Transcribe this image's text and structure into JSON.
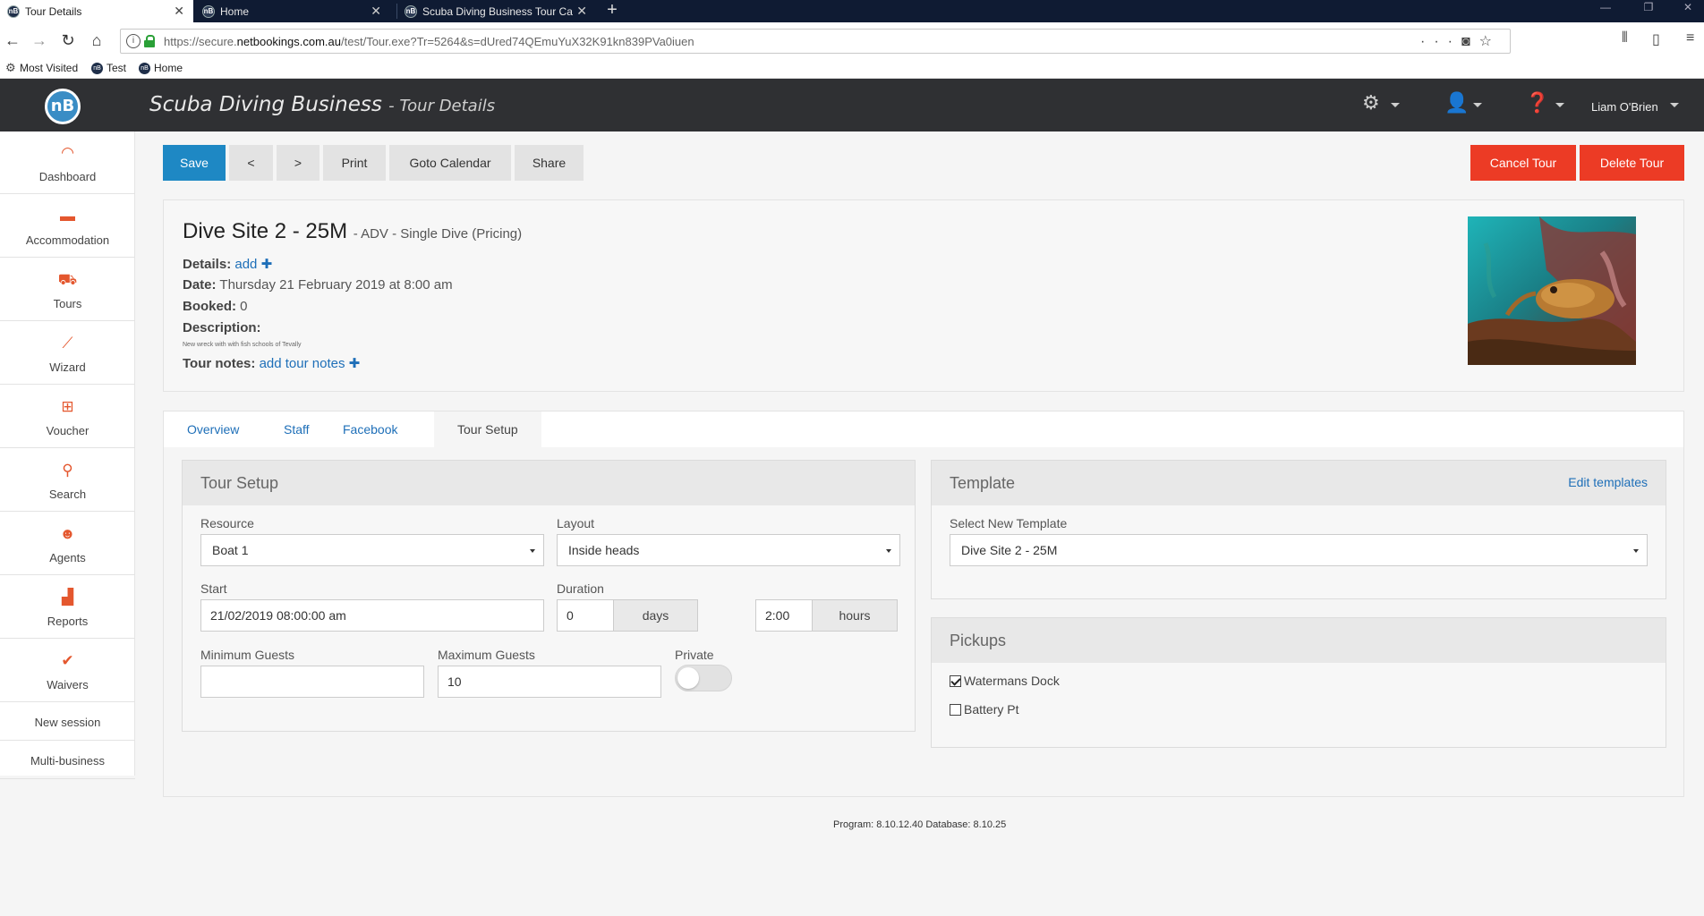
{
  "browser": {
    "tabs": [
      {
        "title": "Tour Details",
        "active": true
      },
      {
        "title": "Home",
        "active": false
      },
      {
        "title": "Scuba Diving Business Tour Ca",
        "active": false
      }
    ],
    "url_prefix": "https://secure.",
    "url_domain": "netbookings.com.au",
    "url_path": "/test/Tour.exe?Tr=5264&s=dUred74QEmuYuX32K91kn839PVa0iuen",
    "bookmarks": [
      "Most Visited",
      "Test",
      "Home"
    ]
  },
  "header": {
    "logo_text": "nB",
    "business_name": "Scuba Diving Business",
    "page_name": "- Tour Details",
    "user_name": "Liam O'Brien"
  },
  "sidebar": {
    "items": [
      {
        "label": "Dashboard",
        "icon": "dashboard-icon"
      },
      {
        "label": "Accommodation",
        "icon": "bed-icon"
      },
      {
        "label": "Tours",
        "icon": "tours-icon"
      },
      {
        "label": "Wizard",
        "icon": "wand-icon"
      },
      {
        "label": "Voucher",
        "icon": "gift-icon"
      },
      {
        "label": "Search",
        "icon": "search-icon"
      },
      {
        "label": "Agents",
        "icon": "agent-icon"
      },
      {
        "label": "Reports",
        "icon": "chart-icon"
      },
      {
        "label": "Waivers",
        "icon": "check-icon"
      }
    ],
    "links": [
      "New session",
      "Multi-business"
    ]
  },
  "toolbar": {
    "save": "Save",
    "prev": "<",
    "next": ">",
    "print": "Print",
    "goto_calendar": "Goto Calendar",
    "share": "Share",
    "cancel_tour": "Cancel Tour",
    "delete_tour": "Delete Tour"
  },
  "tour": {
    "name": "Dive Site 2 - 25M",
    "subtitle": "- ADV - Single Dive (Pricing)",
    "details_label": "Details:",
    "details_link": "add",
    "date_label": "Date:",
    "date_value": "Thursday 21 February 2019 at 8:00 am",
    "booked_label": "Booked:",
    "booked_value": "0",
    "description_label": "Description:",
    "description_value": "New wreck with with fish schools of Tevally",
    "notes_label": "Tour notes:",
    "notes_link": "add tour notes"
  },
  "tabs": [
    "Overview",
    "Staff",
    "Facebook",
    "Tour Setup"
  ],
  "tour_setup": {
    "title": "Tour Setup",
    "resource_label": "Resource",
    "resource_value": "Boat 1",
    "layout_label": "Layout",
    "layout_value": "Inside heads",
    "start_label": "Start",
    "start_value": "21/02/2019 08:00:00 am",
    "duration_label": "Duration",
    "duration_days_value": "0",
    "days_unit": "days",
    "duration_hours_value": "2:00",
    "hours_unit": "hours",
    "min_guests_label": "Minimum Guests",
    "min_guests_value": "",
    "max_guests_label": "Maximum Guests",
    "max_guests_value": "10",
    "private_label": "Private",
    "private_on": false
  },
  "template": {
    "title": "Template",
    "edit_link": "Edit templates",
    "select_label": "Select New Template",
    "select_value": "Dive Site 2 - 25M"
  },
  "pickups": {
    "title": "Pickups",
    "items": [
      {
        "label": "Watermans Dock",
        "checked": true
      },
      {
        "label": "Battery Pt",
        "checked": false
      }
    ]
  },
  "footer": "Program: 8.10.12.40 Database: 8.10.25",
  "colors": {
    "primary": "#1e88c4",
    "danger": "#ec3b25",
    "accent_icon": "#e4572e",
    "header_bg": "#2f3033",
    "link": "#1e6fb8"
  }
}
